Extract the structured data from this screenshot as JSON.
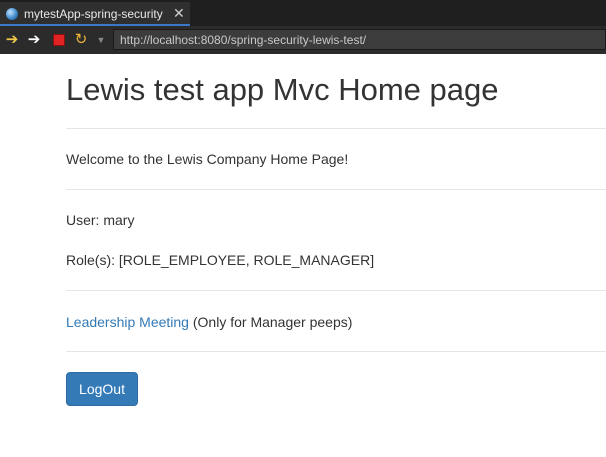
{
  "browser": {
    "tab_title": "mytestApp-spring-security",
    "tab_close": "✕",
    "url": "http://localhost:8080/spring-security-lewis-test/"
  },
  "page": {
    "heading": "Lewis test app Mvc Home page",
    "welcome": "Welcome to the Lewis Company Home Page!",
    "user_line": "User: mary",
    "roles_line": "Role(s): [ROLE_EMPLOYEE, ROLE_MANAGER]",
    "leadership_link": "Leadership Meeting",
    "leadership_note": "(Only for Manager peeps)",
    "logout_button": "LogOut"
  },
  "colors": {
    "link": "#337ab7",
    "button_bg": "#337ab7",
    "tab_accent": "#3a78c8"
  }
}
